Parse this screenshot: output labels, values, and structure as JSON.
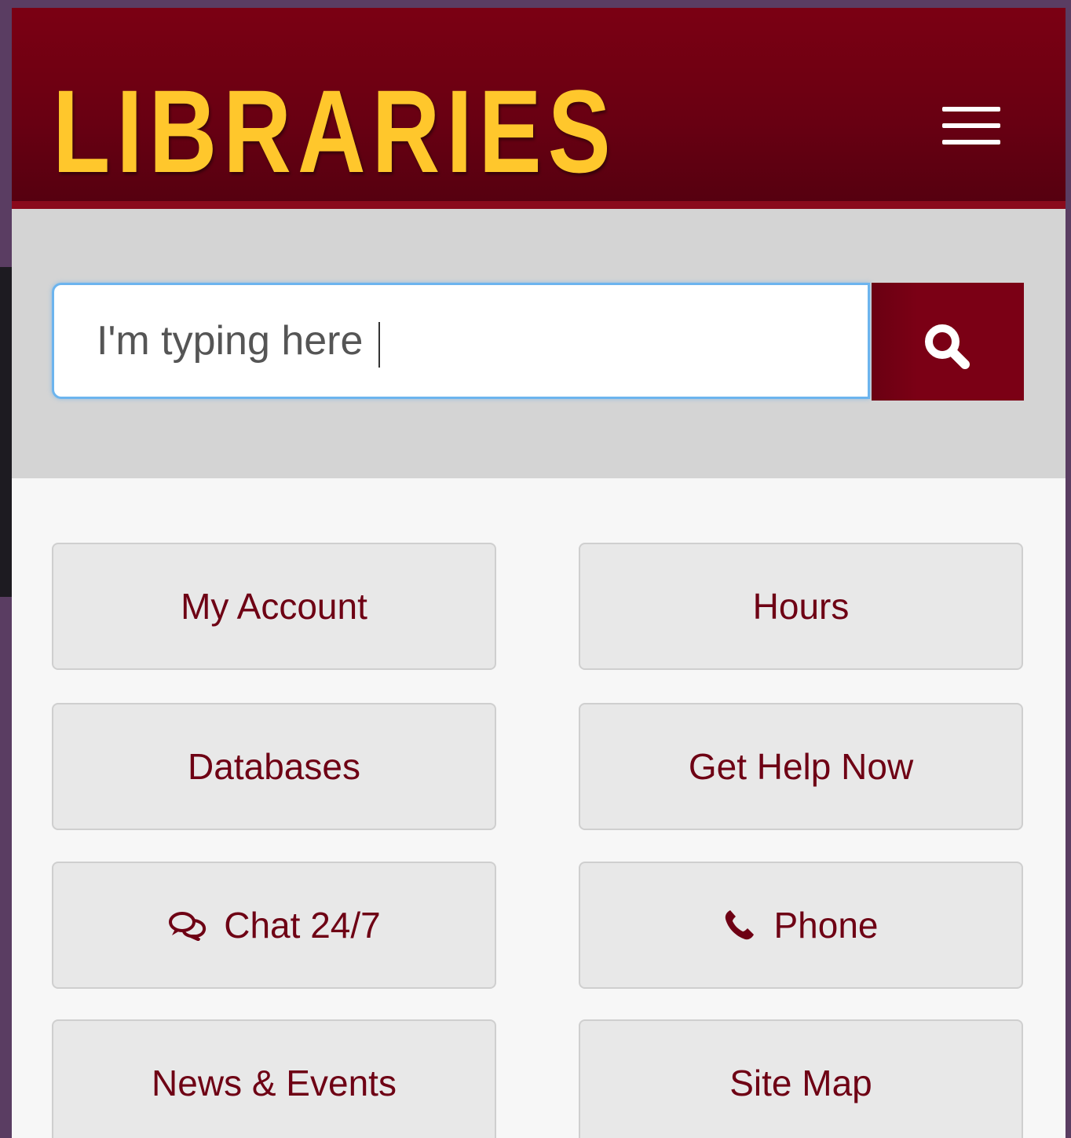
{
  "header": {
    "brand": "LIBRARIES",
    "menu_icon": "hamburger-menu-icon"
  },
  "search": {
    "value": "I'm typing here",
    "button_icon": "search-icon"
  },
  "links": [
    {
      "label": "My Account"
    },
    {
      "label": "Hours"
    },
    {
      "label": "Databases"
    },
    {
      "label": "Get Help Now"
    },
    {
      "label": "Chat 24/7",
      "icon": "chat-bubbles-icon"
    },
    {
      "label": "Phone",
      "icon": "phone-icon"
    },
    {
      "label": "News & Events"
    },
    {
      "label": "Site Map"
    }
  ],
  "colors": {
    "brand_maroon": "#7b0013",
    "brand_gold": "#ffc72c",
    "link_text": "#6e0014",
    "search_band": "#d4d4d4",
    "focus_border": "#6cb4ee"
  }
}
